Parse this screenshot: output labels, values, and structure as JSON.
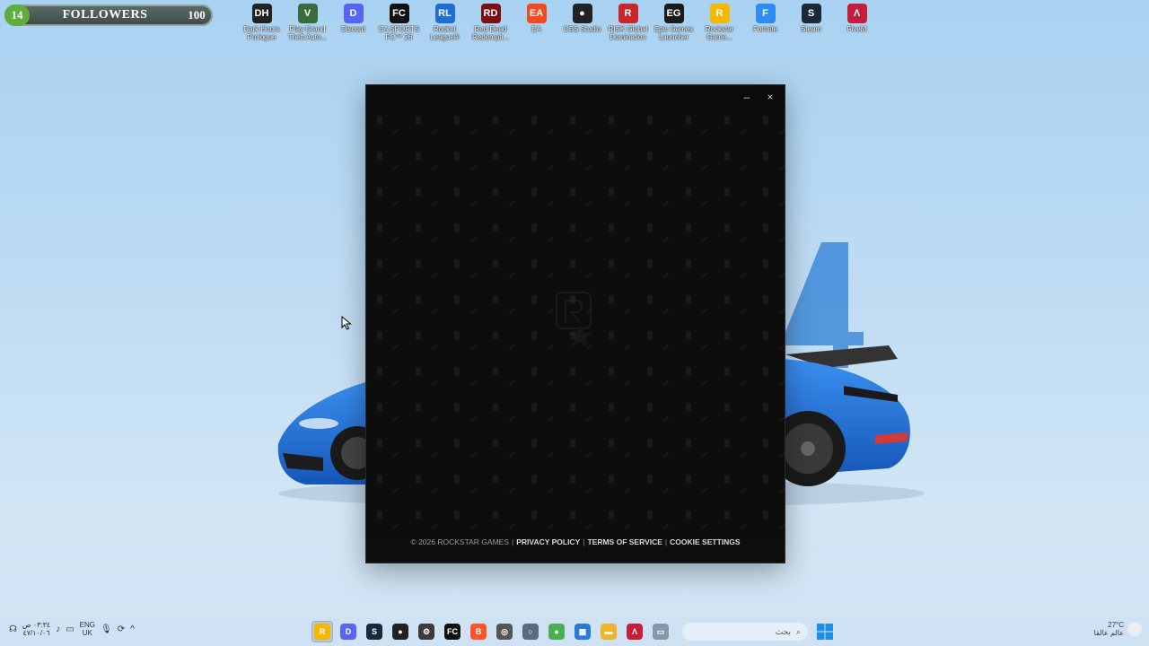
{
  "followers": {
    "current": "14",
    "label": "FOLLOWERS",
    "goal": "100"
  },
  "desktop_icons": [
    {
      "label": "Dark Hours Prologue",
      "icon": "dark-hours-icon",
      "color": "#222222",
      "glyph": "DH"
    },
    {
      "label": "Play Grand Theft Auto...",
      "icon": "gta-icon",
      "color": "#3a6b3a",
      "glyph": "V"
    },
    {
      "label": "Discord",
      "icon": "discord-icon",
      "color": "#5865f2",
      "glyph": "D"
    },
    {
      "label": "EA SPORTS FC™ 26",
      "icon": "ea-fc-icon",
      "color": "#111111",
      "glyph": "FC"
    },
    {
      "label": "Rocket League®",
      "icon": "rocket-league-icon",
      "color": "#1e6fd0",
      "glyph": "RL"
    },
    {
      "label": "Red Dead Redempti...",
      "icon": "red-dead-icon",
      "color": "#7a1010",
      "glyph": "RD"
    },
    {
      "label": "EA",
      "icon": "ea-icon",
      "color": "#f04a1e",
      "glyph": "EA"
    },
    {
      "label": "OBS Studio",
      "icon": "obs-icon",
      "color": "#222222",
      "glyph": "●"
    },
    {
      "label": "RISK Global Domination",
      "icon": "risk-icon",
      "color": "#c8262a",
      "glyph": "R"
    },
    {
      "label": "Epic Games Launcher",
      "icon": "epic-games-icon",
      "color": "#1a1a1a",
      "glyph": "EG"
    },
    {
      "label": "Rockstar Game...",
      "icon": "rockstar-icon",
      "color": "#f5b800",
      "glyph": "R"
    },
    {
      "label": "Fortnite",
      "icon": "fortnite-icon",
      "color": "#2f8cf0",
      "glyph": "F"
    },
    {
      "label": "Steam",
      "icon": "steam-icon",
      "color": "#1b2838",
      "glyph": "S"
    },
    {
      "label": "FiveM",
      "icon": "fivem-icon",
      "color": "#c41e3a",
      "glyph": "Λ"
    }
  ],
  "launcher": {
    "minimize": "–",
    "close": "×",
    "footer": {
      "copyright": "© 2026 ROCKSTAR GAMES",
      "privacy": "PRIVACY POLICY",
      "terms": "TERMS OF SERVICE",
      "cookies": "COOKIE SETTINGS",
      "separator": "|"
    }
  },
  "taskbar": {
    "clock_time": "٠٣:٣٤ ص",
    "clock_date": "٤٧/١٠/٠٦",
    "lang": "ENG",
    "region": "UK",
    "search_placeholder": "بحث",
    "weather_temp": "27°C",
    "weather_text": "عالم عالقا",
    "apps": [
      {
        "icon": "rockstar-launcher-icon",
        "color": "#f5b800",
        "glyph": "R",
        "active": true
      },
      {
        "icon": "discord-icon",
        "color": "#5865f2",
        "glyph": "D"
      },
      {
        "icon": "steam-icon",
        "color": "#1b2838",
        "glyph": "S"
      },
      {
        "icon": "obs-icon",
        "color": "#222222",
        "glyph": "●"
      },
      {
        "icon": "settings-gear-icon",
        "color": "#3b3b3b",
        "glyph": "⚙"
      },
      {
        "icon": "ea-fc-icon",
        "color": "#111111",
        "glyph": "FC"
      },
      {
        "icon": "brave-icon",
        "color": "#fb542b",
        "glyph": "B"
      },
      {
        "icon": "target-icon",
        "color": "#555555",
        "glyph": "◎"
      },
      {
        "icon": "circle-app-icon",
        "color": "#5a6b7a",
        "glyph": "○"
      },
      {
        "icon": "chrome-icon",
        "color": "#4caf50",
        "glyph": "●"
      },
      {
        "icon": "store-icon",
        "color": "#2a7bd8",
        "glyph": "▦"
      },
      {
        "icon": "file-explorer-icon",
        "color": "#f0b429",
        "glyph": "▬"
      },
      {
        "icon": "fivem-icon",
        "color": "#c41e3a",
        "glyph": "Λ"
      },
      {
        "icon": "window-icon",
        "color": "#8a98a6",
        "glyph": "▭"
      }
    ]
  }
}
